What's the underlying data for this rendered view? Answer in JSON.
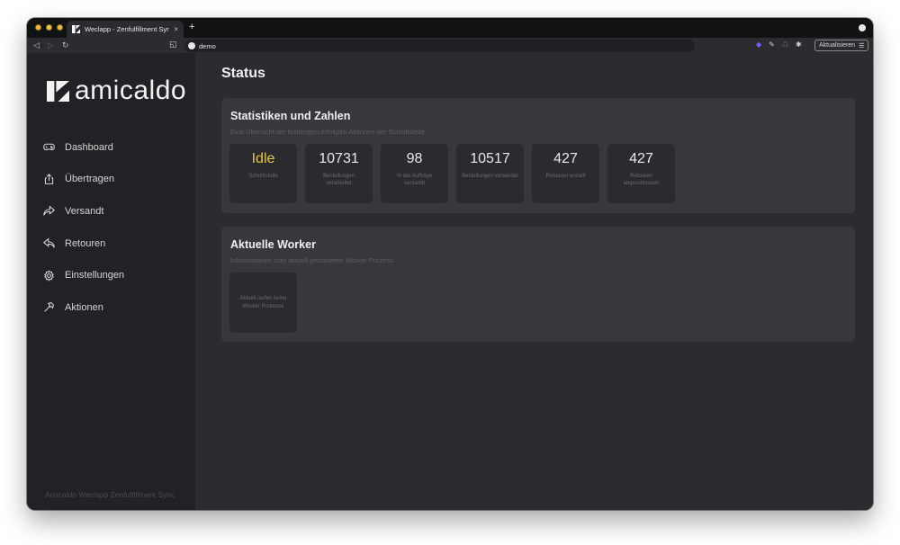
{
  "browser": {
    "tab_title": "Weclapp - Zenfulfillment Sync",
    "tab_close": "×",
    "new_tab": "+",
    "url": "demo",
    "update_button": "Aktualisieren",
    "colors": {
      "light_red": "#f2b23a",
      "light_yellow": "#f2c94c",
      "light_green": "#f2b23a"
    }
  },
  "sidebar": {
    "logo_text": "amicaldo",
    "items": [
      {
        "label": "Dashboard",
        "icon": "gamepad-icon"
      },
      {
        "label": "Übertragen",
        "icon": "upload-icon"
      },
      {
        "label": "Versandt",
        "icon": "share-icon"
      },
      {
        "label": "Retouren",
        "icon": "reply-icon"
      },
      {
        "label": "Einstellungen",
        "icon": "gear-icon"
      },
      {
        "label": "Aktionen",
        "icon": "hammer-icon"
      }
    ],
    "footer": "Amicaldo Weclapp Zenfulfillment Sync"
  },
  "main": {
    "title": "Status",
    "stats_card": {
      "title": "Statistiken und Zahlen",
      "subtitle": "Eine Übersicht der bisherigen erfolgten Aktionen der Schnittstelle.",
      "items": [
        {
          "value": "Idle",
          "label": "Schnittstelle"
        },
        {
          "value": "10731",
          "label": "Bestellungen verarbeitet"
        },
        {
          "value": "98",
          "label": "% der Aufträge versandt"
        },
        {
          "value": "10517",
          "label": "Bestellungen versendet"
        },
        {
          "value": "427",
          "label": "Retouren erstellt"
        },
        {
          "value": "427",
          "label": "Retouren abgeschlossen"
        }
      ]
    },
    "worker_card": {
      "title": "Aktuelle Worker",
      "subtitle": "Informationen zum aktuell gestarteten Worker Prozess.",
      "empty_text": "Aktuell laufen keine Worker Prozesse"
    }
  }
}
